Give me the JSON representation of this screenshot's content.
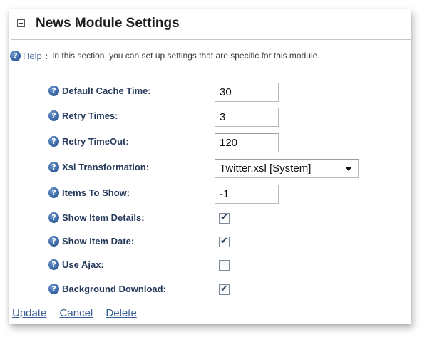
{
  "module": {
    "title": "News Module Settings"
  },
  "help": {
    "link_label": "Help",
    "separator": ":",
    "text": "In this section, you can set up settings that are specific for this module."
  },
  "settings": {
    "default_cache_time": {
      "label": "Default Cache Time:",
      "value": "30"
    },
    "retry_times": {
      "label": "Retry Times:",
      "value": "3"
    },
    "retry_timeout": {
      "label": "Retry TimeOut:",
      "value": "120"
    },
    "xsl_transformation": {
      "label": "Xsl Transformation:",
      "value": "Twitter.xsl [System]"
    },
    "items_to_show": {
      "label": "Items To Show:",
      "value": "-1"
    },
    "show_item_details": {
      "label": "Show Item Details:",
      "checked": true
    },
    "show_item_date": {
      "label": "Show Item Date:",
      "checked": true
    },
    "use_ajax": {
      "label": "Use Ajax:",
      "checked": false
    },
    "background_download": {
      "label": "Background Download:",
      "checked": true
    }
  },
  "icons": {
    "help_glyph": "?",
    "check_glyph": "✔"
  },
  "actions": {
    "update": "Update",
    "cancel": "Cancel",
    "delete": "Delete"
  },
  "colors": {
    "link": "#3a5f96",
    "label": "#263a5c",
    "help_icon": "#3c6aa8"
  }
}
